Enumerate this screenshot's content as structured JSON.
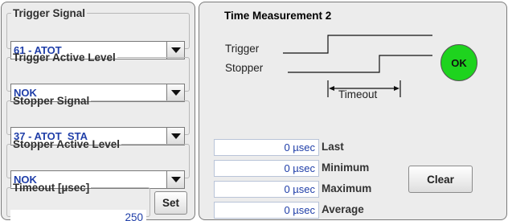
{
  "left": {
    "trigger_signal": {
      "legend": "Trigger Signal",
      "value": "61 - ATOT"
    },
    "trigger_active_level": {
      "legend": "Trigger Active Level",
      "value": "NOK"
    },
    "stopper_signal": {
      "legend": "Stopper Signal",
      "value": "37 - ATOT  STA"
    },
    "stopper_active_level": {
      "legend": "Stopper Active Level",
      "value": "NOK"
    },
    "timeout": {
      "legend": "Timeout [µsec]",
      "value": "250",
      "button": "Set"
    }
  },
  "right": {
    "title": "Time Measurement 2",
    "diagram": {
      "trigger_label": "Trigger",
      "stopper_label": "Stopper",
      "timeout_label": "Timeout"
    },
    "status": {
      "label": "OK",
      "color": "#1ed31e"
    },
    "measurements": [
      {
        "value": "0 µsec",
        "label": "Last"
      },
      {
        "value": "0 µsec",
        "label": "Minimum"
      },
      {
        "value": "0 µsec",
        "label": "Maximum"
      },
      {
        "value": "0 µsec",
        "label": "Average"
      }
    ],
    "clear_button": "Clear"
  },
  "colors": {
    "value_text": "#1f3ea8",
    "ok_green": "#1ed31e"
  }
}
